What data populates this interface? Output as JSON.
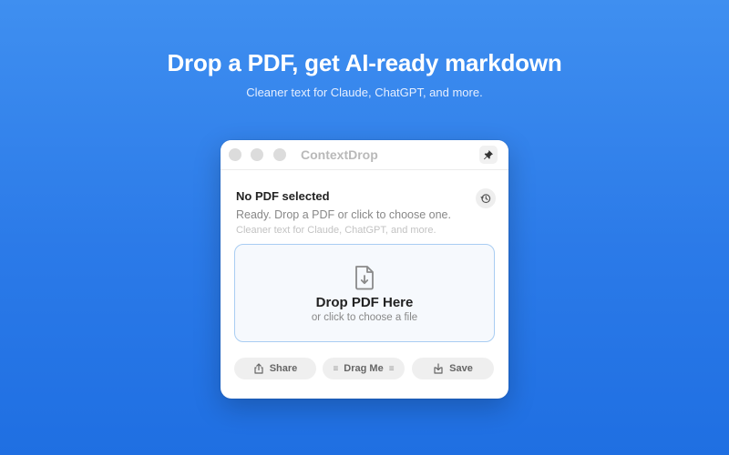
{
  "hero": {
    "title": "Drop a PDF, get AI-ready markdown",
    "subtitle": "Cleaner text for Claude, ChatGPT, and more."
  },
  "window": {
    "title": "ContextDrop",
    "pin_icon": "pin-icon",
    "status": {
      "title": "No PDF selected",
      "message": "Ready. Drop a PDF or click to choose one.",
      "hint": "Cleaner text for Claude, ChatGPT, and more.",
      "history_icon": "history-icon"
    },
    "dropzone": {
      "icon": "document-download-icon",
      "title": "Drop PDF Here",
      "subtitle": "or click to choose a file"
    },
    "actions": {
      "share_label": "Share",
      "share_icon": "share-icon",
      "drag_label": "Drag Me",
      "drag_grip": "≡",
      "save_label": "Save",
      "save_icon": "save-download-icon"
    }
  },
  "colors": {
    "background": "#2b7ae8",
    "dropzone_border": "#a9cdf2",
    "dropzone_fill": "#f6f9fd"
  }
}
